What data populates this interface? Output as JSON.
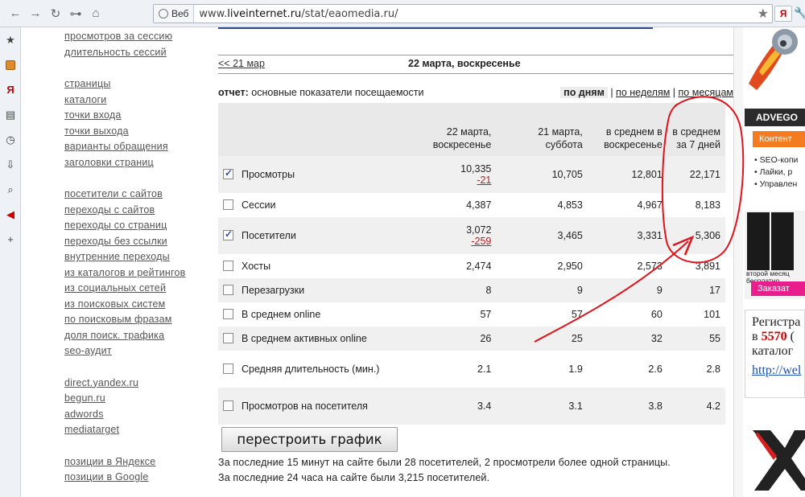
{
  "browser": {
    "web_label": "Веб",
    "url_host": "www.",
    "url_domain": "liveinternet.ru",
    "url_path": "/stat/eaomedia.ru/"
  },
  "leftnav": {
    "group1": [
      "просмотров за сессию",
      "длительность сессий"
    ],
    "group2": [
      "страницы",
      "каталоги",
      "точки входа",
      "точки выхода",
      "варианты обращения",
      "заголовки страниц"
    ],
    "group3": [
      "посетители с сайтов",
      "переходы с сайтов",
      "переходы со страниц",
      "переходы без ссылки",
      "внутренние переходы",
      "из каталогов и рейтингов",
      "из социальных сетей",
      "из поисковых систем",
      "по поисковым фразам",
      "доля поиск. трафика",
      "seo-аудит"
    ],
    "group4": [
      "direct.yandex.ru",
      "begun.ru",
      "adwords",
      "mediatarget"
    ],
    "group5": [
      "позиции в Яндексе",
      "позиции в Google"
    ]
  },
  "datebar": {
    "prev": "<< 21 мар",
    "title": "22 марта, воскресенье"
  },
  "report": {
    "label": "отчет:",
    "name": "основные показатели посещаемости",
    "period_active": "по дням",
    "period_weeks": "по неделям",
    "period_months": "по месяцам",
    "sep": "|"
  },
  "table": {
    "columns": [
      "22 марта, воскресенье",
      "21 марта, суббота",
      "в среднем в воскресенье",
      "в среднем за 7 дней"
    ],
    "rows": [
      {
        "name": "Просмотры",
        "checked": true,
        "v1": "10,335",
        "delta": "-21",
        "v2": "10,705",
        "v3": "12,801",
        "v4": "22,171"
      },
      {
        "name": "Сессии",
        "checked": false,
        "v1": "4,387",
        "delta": "",
        "v2": "4,853",
        "v3": "4,967",
        "v4": "8,183"
      },
      {
        "name": "Посетители",
        "checked": true,
        "v1": "3,072",
        "delta": "-259",
        "v2": "3,465",
        "v3": "3,331",
        "v4": "5,306"
      },
      {
        "name": "Хосты",
        "checked": false,
        "v1": "2,474",
        "delta": "",
        "v2": "2,950",
        "v3": "2,573",
        "v4": "3,891"
      },
      {
        "name": "Перезагрузки",
        "checked": false,
        "v1": "8",
        "delta": "",
        "v2": "9",
        "v3": "9",
        "v4": "17"
      },
      {
        "name": "В среднем online",
        "checked": false,
        "v1": "57",
        "delta": "",
        "v2": "57",
        "v3": "60",
        "v4": "101"
      },
      {
        "name": "В среднем активных online",
        "checked": false,
        "v1": "26",
        "delta": "",
        "v2": "25",
        "v3": "32",
        "v4": "55"
      },
      {
        "name": "Средняя длительность (мин.)",
        "checked": false,
        "v1": "2.1",
        "delta": "",
        "v2": "1.9",
        "v3": "2.6",
        "v4": "2.8"
      },
      {
        "name": "Просмотров на посетителя",
        "checked": false,
        "v1": "3.4",
        "delta": "",
        "v2": "3.1",
        "v3": "3.8",
        "v4": "4.2"
      }
    ]
  },
  "rebuild_label": "перестроить график",
  "footer": {
    "line1": "За последние 15 минут на сайте были 28 посетителей, 2 просмотрели более одной страницы.",
    "line2": "За последние 24 часа на сайте были 3,215 посетителей."
  },
  "ads": {
    "advego_title": "ADVEGO",
    "advego_btn": "Контент",
    "advego_items": [
      "SEO-копи",
      "Лайки, р",
      "Управлен"
    ],
    "server_caption": "второй месяц бесплатно",
    "server_btn": "Заказат",
    "reg_title": "Регистра",
    "reg_in": "в",
    "reg_num": "5570",
    "reg_num_suffix": "(",
    "reg_cat": "каталог",
    "reg_link": "http://wel"
  },
  "colors": {
    "annotation": "#e0141b",
    "delta": "#b22222",
    "header_bg": "#e9e9e9"
  }
}
